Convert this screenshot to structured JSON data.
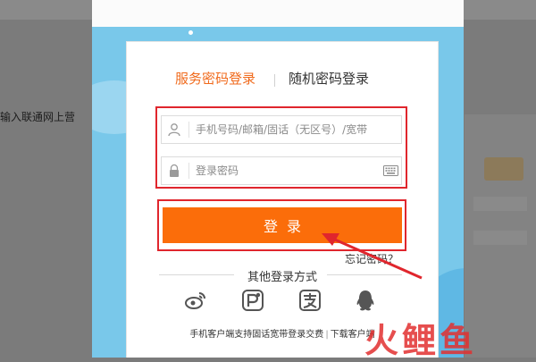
{
  "background": {
    "partial_text": "输入联通网上营"
  },
  "login": {
    "tabs": [
      {
        "label": "服务密码登录",
        "active": true
      },
      {
        "label": "随机密码登录",
        "active": false
      }
    ],
    "phone_placeholder": "手机号码/邮箱/固话（无区号）/宽带",
    "password_placeholder": "登录密码",
    "submit_label": "登录",
    "forgot_label": "忘记密码？",
    "other_methods_title": "其他登录方式",
    "social_icons": [
      "weibo-icon",
      "wo-pay-icon",
      "alipay-icon",
      "qq-icon"
    ],
    "footer": {
      "client_text": "手机客户端支持固话宽带登录交费",
      "separator": "|",
      "download_label": "下载客户端"
    }
  },
  "watermark": "火鲤鱼",
  "colors": {
    "accent": "#f06a1c",
    "button": "#fb6d0a",
    "highlight": "#e0262d",
    "modal_bg": "#79c8ea"
  }
}
